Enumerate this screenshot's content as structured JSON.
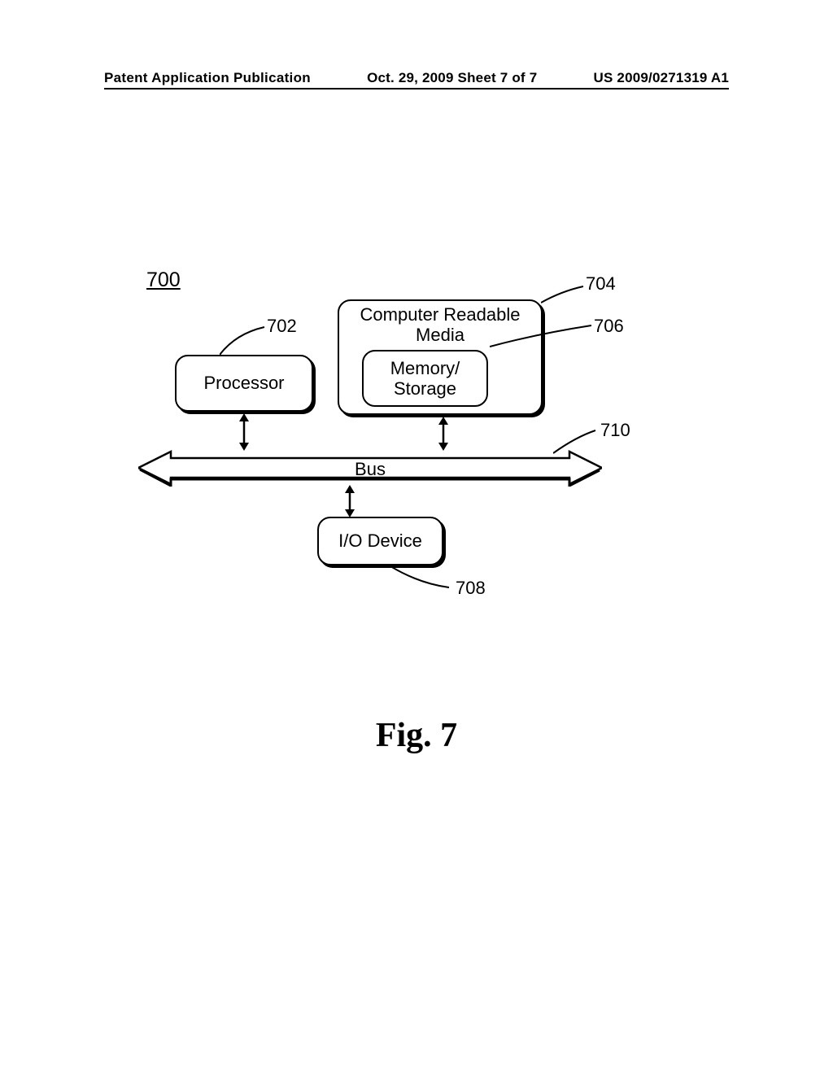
{
  "header": {
    "left": "Patent Application Publication",
    "center": "Oct. 29, 2009  Sheet 7 of 7",
    "right": "US 2009/0271319 A1"
  },
  "diagram": {
    "figure_ref": "700",
    "processor": {
      "label": "Processor",
      "ref": "702"
    },
    "crm": {
      "label_line1": "Computer Readable",
      "label_line2": "Media",
      "ref": "704"
    },
    "memory": {
      "label_line1": "Memory/",
      "label_line2": "Storage",
      "ref": "706"
    },
    "bus": {
      "label": "Bus",
      "ref": "710"
    },
    "io": {
      "label": "I/O Device",
      "ref": "708"
    }
  },
  "caption": "Fig. 7"
}
